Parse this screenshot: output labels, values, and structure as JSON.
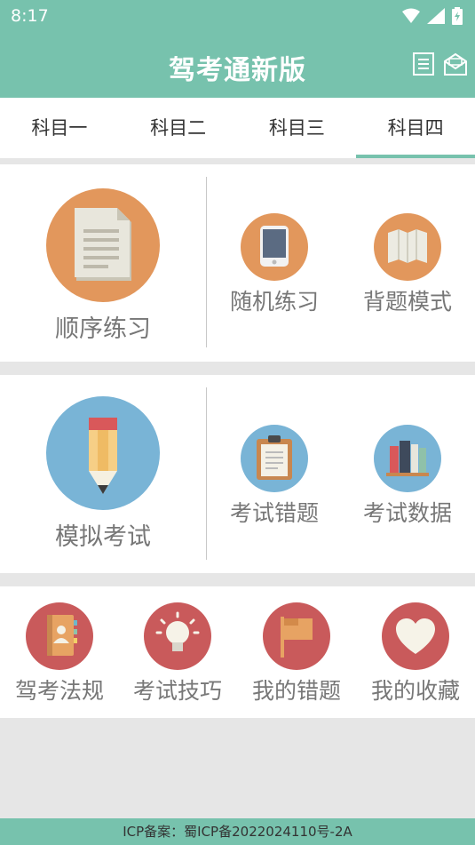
{
  "status": {
    "time": "8:17"
  },
  "app": {
    "title": "驾考通新版"
  },
  "tabs": [
    {
      "label": "科目一",
      "active": false
    },
    {
      "label": "科目二",
      "active": false
    },
    {
      "label": "科目三",
      "active": false
    },
    {
      "label": "科目四",
      "active": true
    }
  ],
  "practice": {
    "main_label": "顺序练习",
    "item1_label": "随机练习",
    "item2_label": "背题模式"
  },
  "exam": {
    "main_label": "模拟考试",
    "item1_label": "考试错题",
    "item2_label": "考试数据"
  },
  "extras": [
    {
      "label": "驾考法规",
      "icon": "address-book-icon"
    },
    {
      "label": "考试技巧",
      "icon": "lightbulb-icon"
    },
    {
      "label": "我的错题",
      "icon": "flag-icon"
    },
    {
      "label": "我的收藏",
      "icon": "heart-icon"
    }
  ],
  "footer": {
    "text": "ICP备案：蜀ICP备2022024110号-2A"
  },
  "colors": {
    "primary": "#77c2ad",
    "orange": "#e2975c",
    "blue": "#79b4d6",
    "red": "#c95a5b"
  }
}
